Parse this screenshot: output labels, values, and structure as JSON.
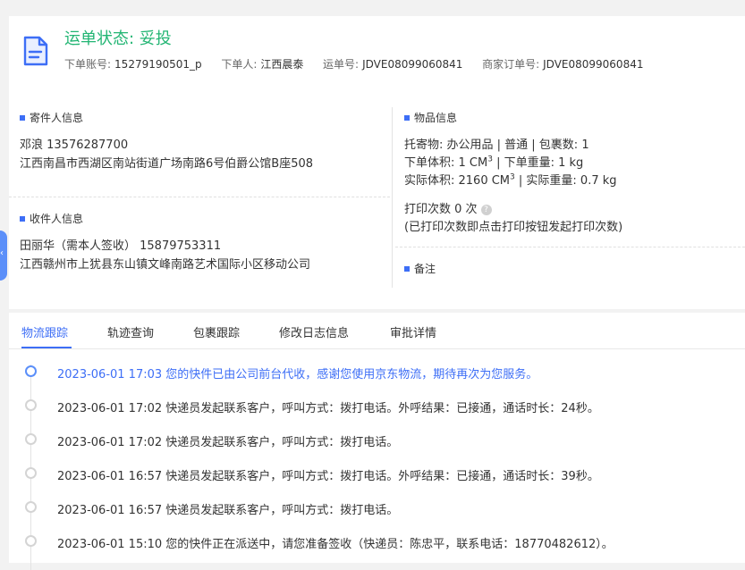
{
  "header": {
    "status_label": "运单状态: 妥投",
    "account_key": "下单账号:",
    "account_value": "15279190501_p",
    "orderer_key": "下单人:",
    "orderer_value": "江西晨泰",
    "waybill_key": "运单号:",
    "waybill_value": "JDVE08099060841",
    "merchant_key": "商家订单号:",
    "merchant_value": "JDVE08099060841"
  },
  "sender": {
    "section_title": "寄件人信息",
    "name_phone": "邓浪   13576287700",
    "address": "江西南昌市西湖区南站街道广场南路6号伯爵公馆B座508"
  },
  "receiver": {
    "section_title": "收件人信息",
    "name_phone": "田丽华（需本人签收）  15879753311",
    "address": "江西赣州市上犹县东山镇文峰南路艺术国际小区移动公司"
  },
  "goods": {
    "section_title": "物品信息",
    "line1": "托寄物:  办公用品 | 普通  | 包裹数:  1",
    "line2_a": "下单体积:   1 CM",
    "line2_b": "  |  下单重量:   1 kg",
    "line3_a": "实际体积:   2160 CM",
    "line3_b": "  |  实际重量:   0.7 kg",
    "sup": "3",
    "print_label": "打印次数    0 次",
    "print_note": "(已打印次数即点击打印按钮发起打印次数)"
  },
  "remark": {
    "section_title": "备注"
  },
  "tabs": [
    "物流跟踪",
    "轨迹查询",
    "包裹跟踪",
    "修改日志信息",
    "审批详情"
  ],
  "timeline": [
    "2023-06-01 17:03  您的快件已由公司前台代收，感谢您使用京东物流，期待再次为您服务。",
    "2023-06-01 17:02  快递员发起联系客户，呼叫方式：拨打电话。外呼结果：已接通，通话时长：24秒。",
    "2023-06-01 17:02  快递员发起联系客户，呼叫方式：拨打电话。",
    "2023-06-01 16:57  快递员发起联系客户，呼叫方式：拨打电话。外呼结果：已接通，通话时长：39秒。",
    "2023-06-01 16:57  快递员发起联系客户，呼叫方式：拨打电话。",
    "2023-06-01 15:10  您的快件正在派送中，请您准备签收（快递员：陈忠平，联系电话：18770482612）。"
  ],
  "colors": {
    "status_green": "#22b573",
    "accent_blue": "#3d6ef6"
  }
}
